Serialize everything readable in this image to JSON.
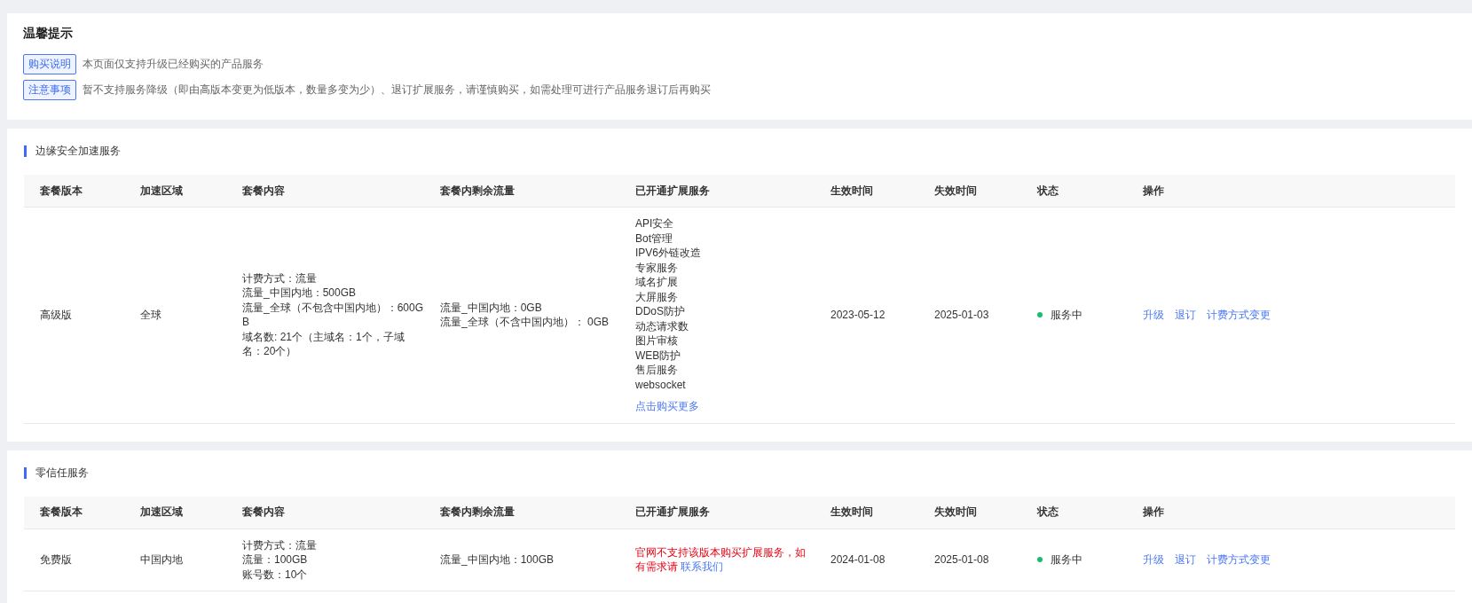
{
  "notice": {
    "title": "温馨提示",
    "items": [
      {
        "tag": "购买说明",
        "text": "本页面仅支持升级已经购买的产品服务"
      },
      {
        "tag": "注意事项",
        "text": "暂不支持服务降级（即由高版本变更为低版本，数量多变为少）、退订扩展服务，请谨慎购买，如需处理可进行产品服务退订后再购买"
      }
    ]
  },
  "sections": [
    {
      "title": "边缘安全加速服务",
      "columns": [
        "套餐版本",
        "加速区域",
        "套餐内容",
        "套餐内剩余流量",
        "已开通扩展服务",
        "生效时间",
        "失效时间",
        "状态",
        "操作"
      ],
      "rows": [
        {
          "version": "高级版",
          "region": "全球",
          "content": [
            "计费方式：流量",
            "流量_中国内地：500GB",
            "流量_全球（不包含中国内地）：600GB",
            "域名数: 21个（主域名：1个，子域名：20个）"
          ],
          "remaining": [
            "流量_中国内地：0GB",
            "流量_全球（不含中国内地）： 0GB"
          ],
          "extensions": {
            "kind": "list",
            "items": [
              "API安全",
              "Bot管理",
              "IPV6外链改造",
              "专家服务",
              "域名扩展",
              "大屏服务",
              "DDoS防护",
              "动态请求数",
              "图片审核",
              "WEB防护",
              "售后服务",
              "websocket"
            ],
            "link": "点击购买更多"
          },
          "start": "2023-05-12",
          "end": "2025-01-03",
          "status": {
            "text": "服务中",
            "color": "#19be6b"
          },
          "actions": [
            "升级",
            "退订",
            "计费方式变更"
          ]
        }
      ]
    },
    {
      "title": "零信任服务",
      "columns": [
        "套餐版本",
        "加速区域",
        "套餐内容",
        "套餐内剩余流量",
        "已开通扩展服务",
        "生效时间",
        "失效时间",
        "状态",
        "操作"
      ],
      "rows": [
        {
          "version": "免费版",
          "region": "中国内地",
          "content": [
            "计费方式：流量",
            "流量：100GB",
            "账号数：10个"
          ],
          "remaining": [
            "流量_中国内地：100GB"
          ],
          "extensions": {
            "kind": "notice",
            "text": "官网不支持该版本购买扩展服务，如有需求请",
            "link": "联系我们"
          },
          "start": "2024-01-08",
          "end": "2025-01-08",
          "status": {
            "text": "服务中",
            "color": "#19be6b"
          },
          "actions": [
            "升级",
            "退订",
            "计费方式变更"
          ]
        }
      ]
    }
  ]
}
